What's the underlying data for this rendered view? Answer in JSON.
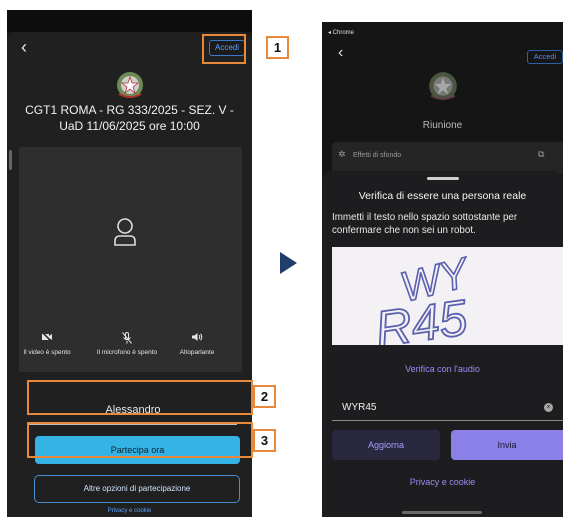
{
  "left": {
    "back_glyph": "‹",
    "accedi": "Accedi",
    "meeting_title": "CGT1 ROMA - RG 333/2025 - SEZ. V - UaD 11/06/2025 ore 10:00",
    "controls": [
      {
        "icon": "video-off-icon",
        "label": "Il video è spento"
      },
      {
        "icon": "mic-off-icon",
        "label": "Il microfono è spento"
      },
      {
        "icon": "speaker-icon",
        "label": "Altoparlante"
      }
    ],
    "name_value": "Alessandro",
    "join_button": "Partecipa ora",
    "other_options": "Altre opzioni di partecipazione",
    "privacy": "Privacy e cookie"
  },
  "annotations": [
    "1",
    "2",
    "3"
  ],
  "right": {
    "browser_label": "◂ Chrome",
    "back_glyph": "‹",
    "accedi": "Accedi",
    "meeting_name": "Riunione",
    "effects_label": "Effetti di sfondo",
    "heading": "Verifica di essere una persona reale",
    "description": "Immetti il testo nello spazio sottostante per confermare che non sei un robot.",
    "captcha_text": [
      "WY",
      "R45"
    ],
    "audio_link": "Verifica con l'audio",
    "input_value": "WYR45",
    "refresh_button": "Aggiorna",
    "submit_button": "Invia",
    "privacy": "Privacy e cookie"
  },
  "colors": {
    "annotation": "#e8893a",
    "join_blue": "#34b3e4",
    "purple_accent": "#8a80e8",
    "arrow": "#203d6b"
  }
}
